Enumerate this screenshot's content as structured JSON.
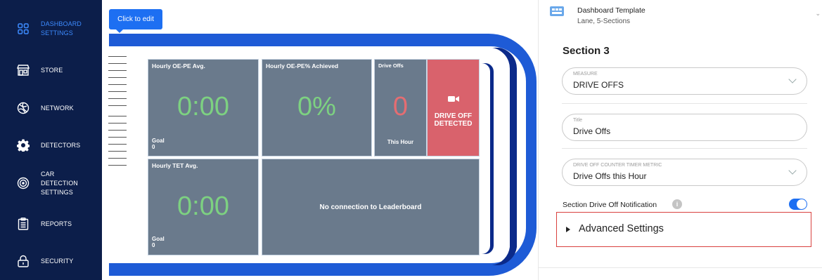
{
  "sidebar": {
    "items": [
      {
        "label": "DASHBOARD SETTINGS",
        "icon": "grid-icon",
        "active": true
      },
      {
        "label": "STORE",
        "icon": "store-icon",
        "active": false
      },
      {
        "label": "NETWORK",
        "icon": "network-icon",
        "active": false
      },
      {
        "label": "DETECTORS",
        "icon": "gear-icon",
        "active": false
      },
      {
        "label": "CAR DETECTION SETTINGS",
        "icon": "car-detection-icon",
        "active": false
      },
      {
        "label": "REPORTS",
        "icon": "clipboard-icon",
        "active": false
      },
      {
        "label": "SECURITY",
        "icon": "lock-icon",
        "active": false
      }
    ]
  },
  "preview": {
    "tooltip": "Click to edit",
    "tiles": {
      "oepe_avg": {
        "title": "Hourly OE-PE Avg.",
        "value": "0:00",
        "goal_label": "Goal",
        "goal_value": "0"
      },
      "oepe_pct": {
        "title": "Hourly OE-PE% Achieved",
        "value": "0%"
      },
      "drive_offs": {
        "title": "Drive Offs",
        "value": "0",
        "caption": "This Hour"
      },
      "drive_off_alert": {
        "line1": "DRIVE OFF",
        "line2": "DETECTED",
        "icon": "video-camera-icon"
      },
      "tet_avg": {
        "title": "Hourly TET Avg.",
        "value": "0:00",
        "goal_label": "Goal",
        "goal_value": "0"
      },
      "leaderboard": {
        "message": "No connection to Leaderboard"
      }
    }
  },
  "panel": {
    "template": {
      "title": "Dashboard Template",
      "subtitle": "Lane, 5-Sections"
    },
    "section_title": "Section 3",
    "measure": {
      "caption": "MEASURE",
      "value": "DRIVE OFFS"
    },
    "title_field": {
      "caption": "Title",
      "value": "Drive Offs"
    },
    "metric": {
      "caption": "DRIVE OFF COUNTER TIMER METRIC",
      "value": "Drive Offs this Hour"
    },
    "notification": {
      "label": "Section Drive Off Notification",
      "enabled": true
    },
    "advanced": {
      "label": "Advanced Settings"
    }
  },
  "colors": {
    "sidebar_bg": "#0c1e4a",
    "accent": "#1d6ff2",
    "tile_bg": "#6a7a8c",
    "value_green": "#7dd181",
    "alert_red": "#d9626c",
    "highlight_border": "#d9413f"
  }
}
